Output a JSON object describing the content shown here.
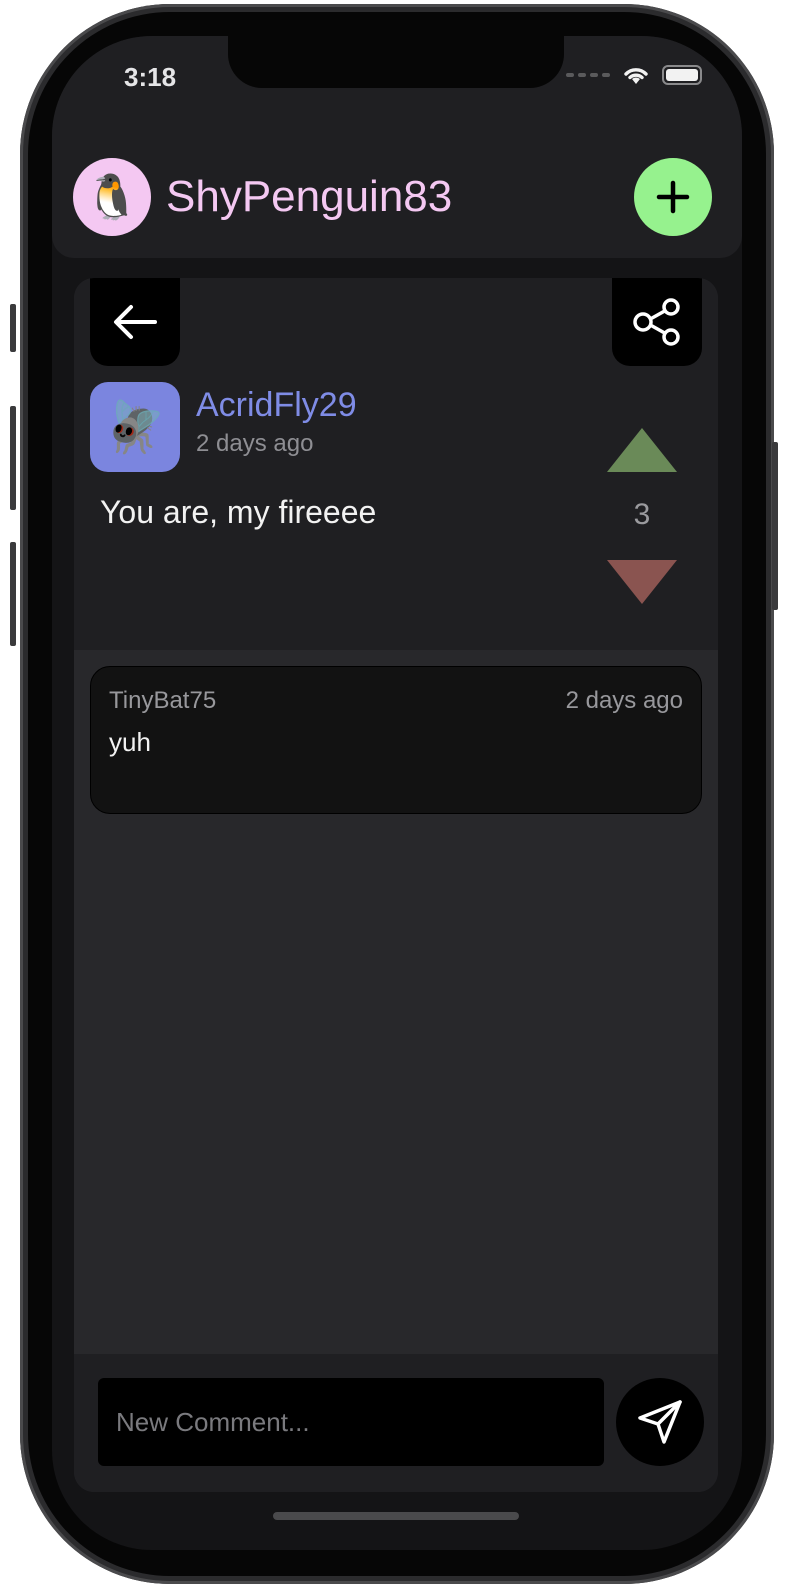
{
  "status_bar": {
    "time": "3:18",
    "icons": [
      "cellular-signal-icon",
      "wifi-icon",
      "battery-icon"
    ]
  },
  "header": {
    "avatar_emoji": "🐧",
    "username": "ShyPenguin83",
    "add_icon": "plus-icon"
  },
  "post": {
    "back_icon": "arrow-left-icon",
    "share_icon": "share-icon",
    "author": {
      "avatar_emoji": "🪰",
      "name": "AcridFly29",
      "time": "2 days ago"
    },
    "text": "You are, my fireeee",
    "votes": {
      "count": "3",
      "up_icon": "triangle-up-icon",
      "down_icon": "triangle-down-icon"
    }
  },
  "comments": [
    {
      "author": "TinyBat75",
      "time": "2 days ago",
      "text": "yuh"
    }
  ],
  "footer": {
    "input_placeholder": "New Comment...",
    "input_value": "",
    "send_icon": "send-icon"
  },
  "colors": {
    "header_bg": "#1f1f22",
    "card_bg": "#28282b",
    "username": "#f4c8f2",
    "author_name": "#7f8ce6",
    "add_button": "#96f28e",
    "upvote": "#6a8a58",
    "downvote": "#8a5450",
    "author_avatar_bg": "#7b85df"
  }
}
